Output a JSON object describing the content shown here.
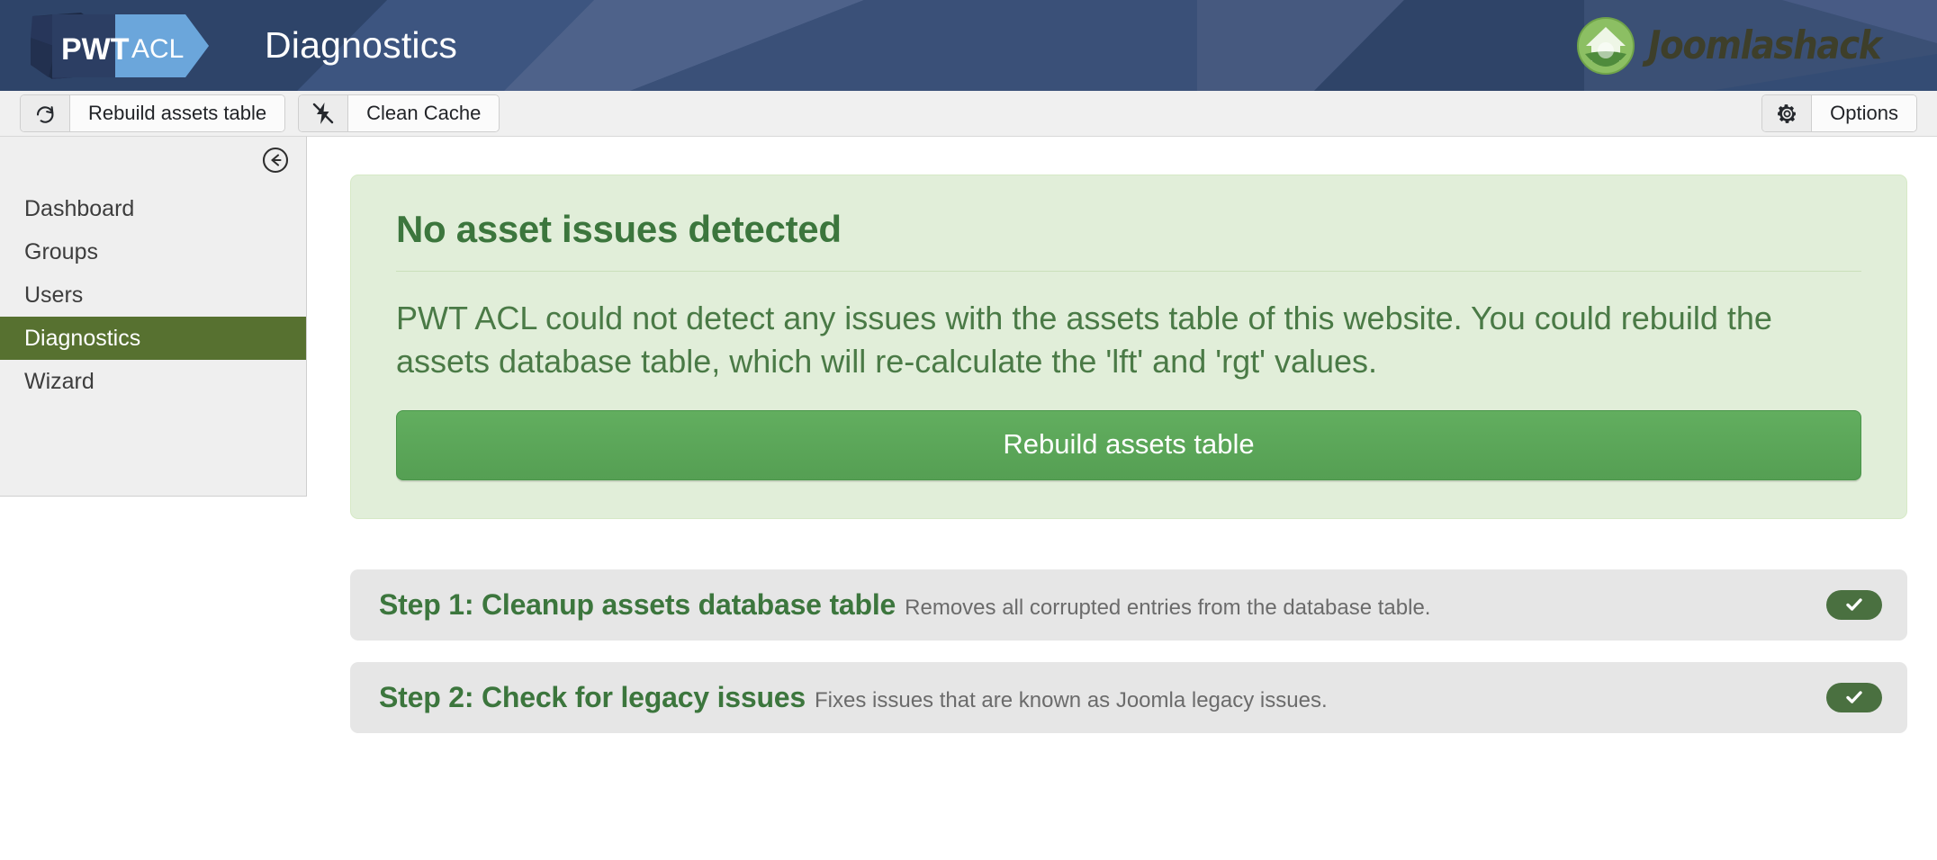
{
  "header": {
    "brand": {
      "left_text": "PWT",
      "right_text": "ACL"
    },
    "page_title": "Diagnostics",
    "vendor": {
      "name": "Joomlashack",
      "icon": "shack-house-icon"
    },
    "colors": {
      "background": "#344c74",
      "brand_left": "#2c3e63",
      "brand_right": "#5b9bd5"
    }
  },
  "toolbar": {
    "buttons": [
      {
        "icon": "refresh-icon",
        "label": "Rebuild assets table"
      },
      {
        "icon": "lightning-slash-icon",
        "label": "Clean Cache"
      }
    ],
    "options": {
      "icon": "gear-icon",
      "label": "Options"
    }
  },
  "sidebar": {
    "collapse_icon": "circle-arrow-left-icon",
    "items": [
      {
        "label": "Dashboard",
        "active": false
      },
      {
        "label": "Groups",
        "active": false
      },
      {
        "label": "Users",
        "active": false
      },
      {
        "label": "Diagnostics",
        "active": true
      },
      {
        "label": "Wizard",
        "active": false
      }
    ],
    "active_color": "#577130"
  },
  "main": {
    "alert": {
      "heading": "No asset issues detected",
      "text": "PWT ACL could not detect any issues with the assets table of this website. You could rebuild the assets database table, which will re-calculate the 'lft' and 'rgt' values.",
      "button_label": "Rebuild assets table",
      "background": "#e1eed9",
      "heading_color": "#3c763d",
      "button_color": "#5cab5b"
    },
    "steps": [
      {
        "title": "Step 1: Cleanup assets database table",
        "description": "Removes all corrupted entries from the database table.",
        "toggle": {
          "state": "on",
          "icon": "check-icon"
        }
      },
      {
        "title": "Step 2: Check for legacy issues",
        "description": "Fixes issues that are known as Joomla legacy issues.",
        "toggle": {
          "state": "on",
          "icon": "check-icon"
        }
      }
    ]
  }
}
